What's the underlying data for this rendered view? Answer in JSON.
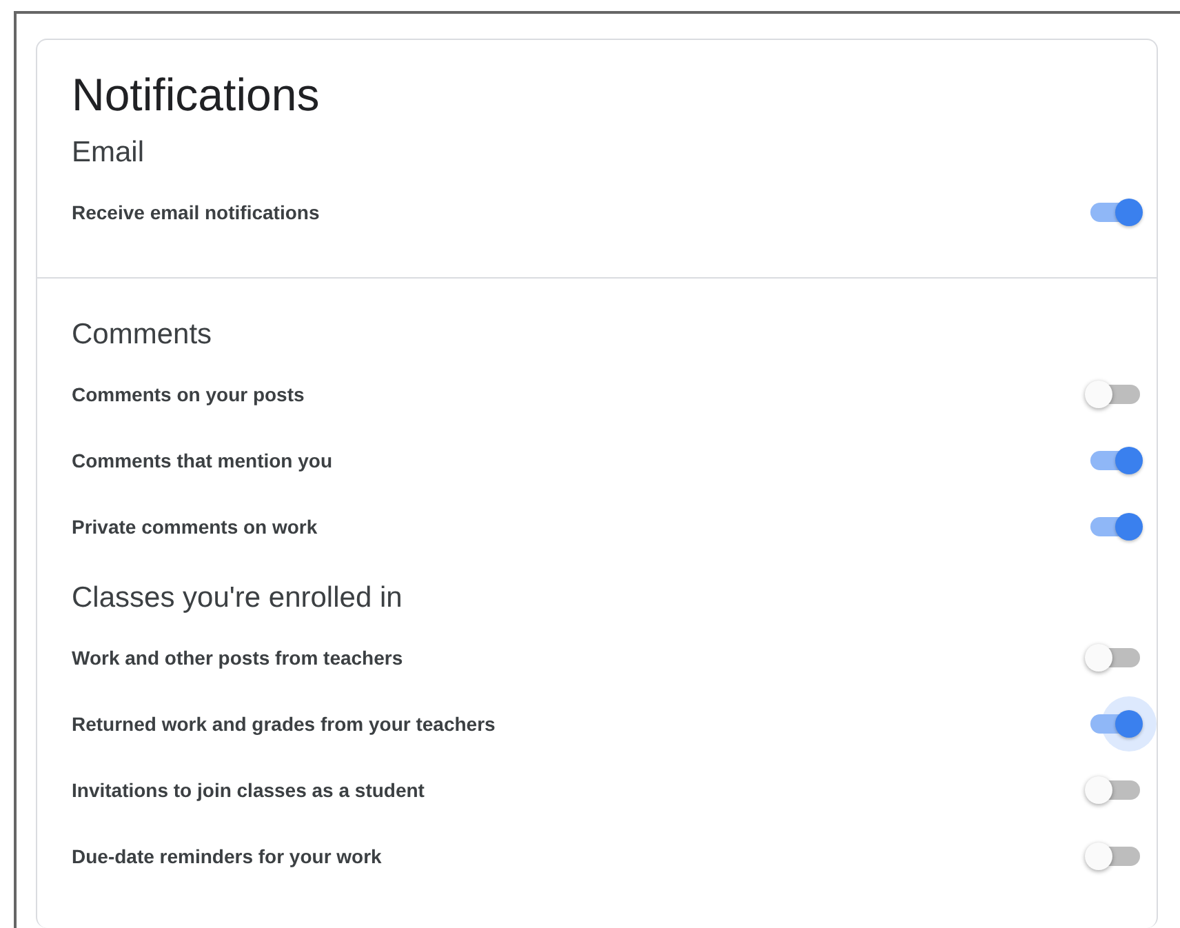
{
  "title": "Notifications",
  "sections": [
    {
      "heading": "Email",
      "settings": [
        {
          "label": "Receive email notifications",
          "on": true,
          "focused": false
        }
      ]
    },
    {
      "heading": "Comments",
      "settings": [
        {
          "label": "Comments on your posts",
          "on": false,
          "focused": false
        },
        {
          "label": "Comments that mention you",
          "on": true,
          "focused": false
        },
        {
          "label": "Private comments on work",
          "on": true,
          "focused": false
        }
      ]
    },
    {
      "heading": "Classes you're enrolled in",
      "settings": [
        {
          "label": "Work and other posts from teachers",
          "on": false,
          "focused": false
        },
        {
          "label": "Returned work and grades from your teachers",
          "on": true,
          "focused": true
        },
        {
          "label": "Invitations to join classes as a student",
          "on": false,
          "focused": false
        },
        {
          "label": "Due-date reminders for your work",
          "on": false,
          "focused": false
        }
      ]
    }
  ]
}
